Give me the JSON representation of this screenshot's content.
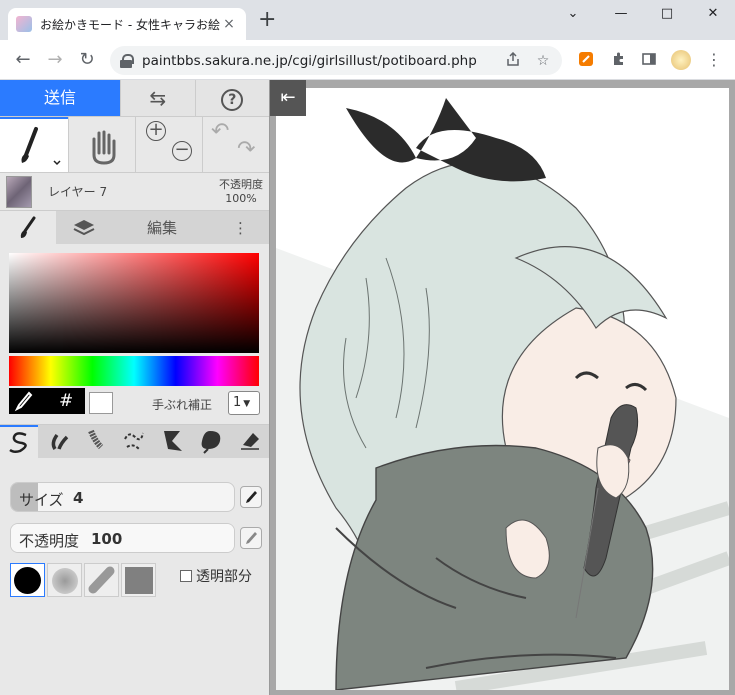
{
  "browser": {
    "tab_title": "お絵かきモード - 女性キャラお絵かき掲示板",
    "tab_close": "×",
    "new_tab": "+",
    "window_controls": [
      "⌄",
      "—",
      "□",
      "✕"
    ],
    "url": "paintbbs.sakura.ne.jp/cgi/girlsillust/potiboard.php",
    "nav": {
      "back": "←",
      "forward": "→",
      "reload": "↻"
    }
  },
  "app": {
    "top": {
      "send_label": "送信",
      "swap_icon": "⇆",
      "help_icon": "?"
    },
    "tools": {
      "zoom_in": "+",
      "zoom_out": "−",
      "undo": "↶",
      "redo": "↷"
    },
    "layer": {
      "name": "レイヤー 7",
      "opacity_label": "不透明度",
      "opacity_value": "100%"
    },
    "tabs": {
      "edit_label": "編集",
      "more_icon": "⋮"
    },
    "color": {
      "hash_label": "#",
      "stabilizer_label": "手ぶれ補正",
      "stabilizer_value": "1"
    },
    "brush": {
      "size_label": "サイズ",
      "size_value": "4",
      "size_level": 0.12,
      "opacity_label": "不透明度",
      "opacity_value": "100",
      "opacity_level": 1.0,
      "transparent_label": "透明部分"
    },
    "canvas": {
      "collapse_icon": "⇤"
    }
  },
  "colors": {
    "accent": "#2b7bff",
    "panel": "#e8e8e8",
    "background": "#a8a8a8"
  }
}
